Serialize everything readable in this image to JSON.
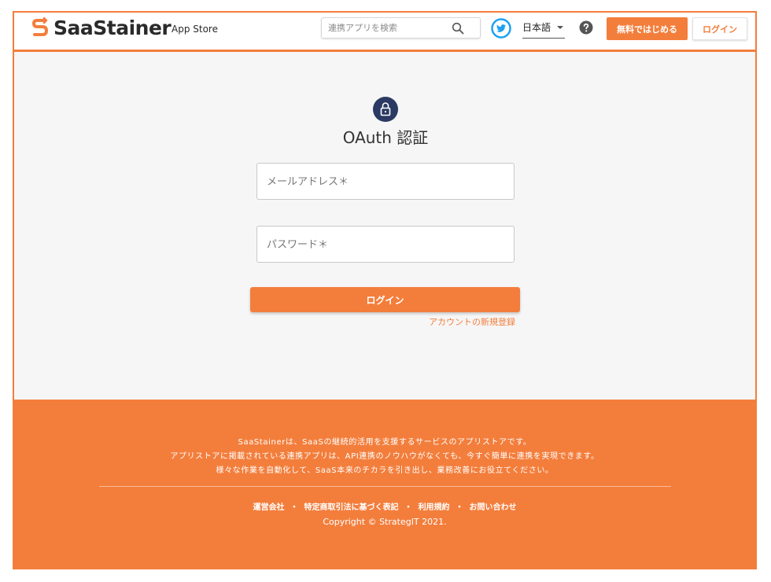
{
  "header": {
    "brand": "SaaStainer",
    "brand_sub": "App Store",
    "search_placeholder": "連携アプリを検索",
    "language": "日本語",
    "signup_label": "無料ではじめる",
    "login_label": "ログイン",
    "icons": {
      "logo": "saastainer-s-logo",
      "search": "search-icon",
      "twitter": "twitter-icon",
      "help": "help-icon"
    }
  },
  "main": {
    "icon": "lock-icon",
    "title": "OAuth 認証",
    "email_placeholder": "メールアドレス＊",
    "password_placeholder": "パスワード＊",
    "login_label": "ログイン",
    "register_link": "アカウントの新規登録"
  },
  "footer": {
    "description": [
      "SaaStainerは、SaaSの継続的活用を支援するサービスのアプリストアです。",
      "アプリストアに掲載されている連携アプリは、API連携のノウハウがなくても、今すぐ簡単に連携を実現できます。",
      "様々な作業を自動化して、SaaS本来のチカラを引き出し、業務改善にお役立てください。"
    ],
    "links": [
      "運営会社",
      "特定商取引法に基づく表記",
      "利用規約",
      "お問い合わせ"
    ],
    "separator": "・",
    "copyright": "Copyright © StrategIT 2021."
  },
  "colors": {
    "accent": "#f37e3c",
    "lock_badge": "#2b3a63",
    "twitter": "#1da1f2",
    "page_bg": "#f6f6f6"
  }
}
